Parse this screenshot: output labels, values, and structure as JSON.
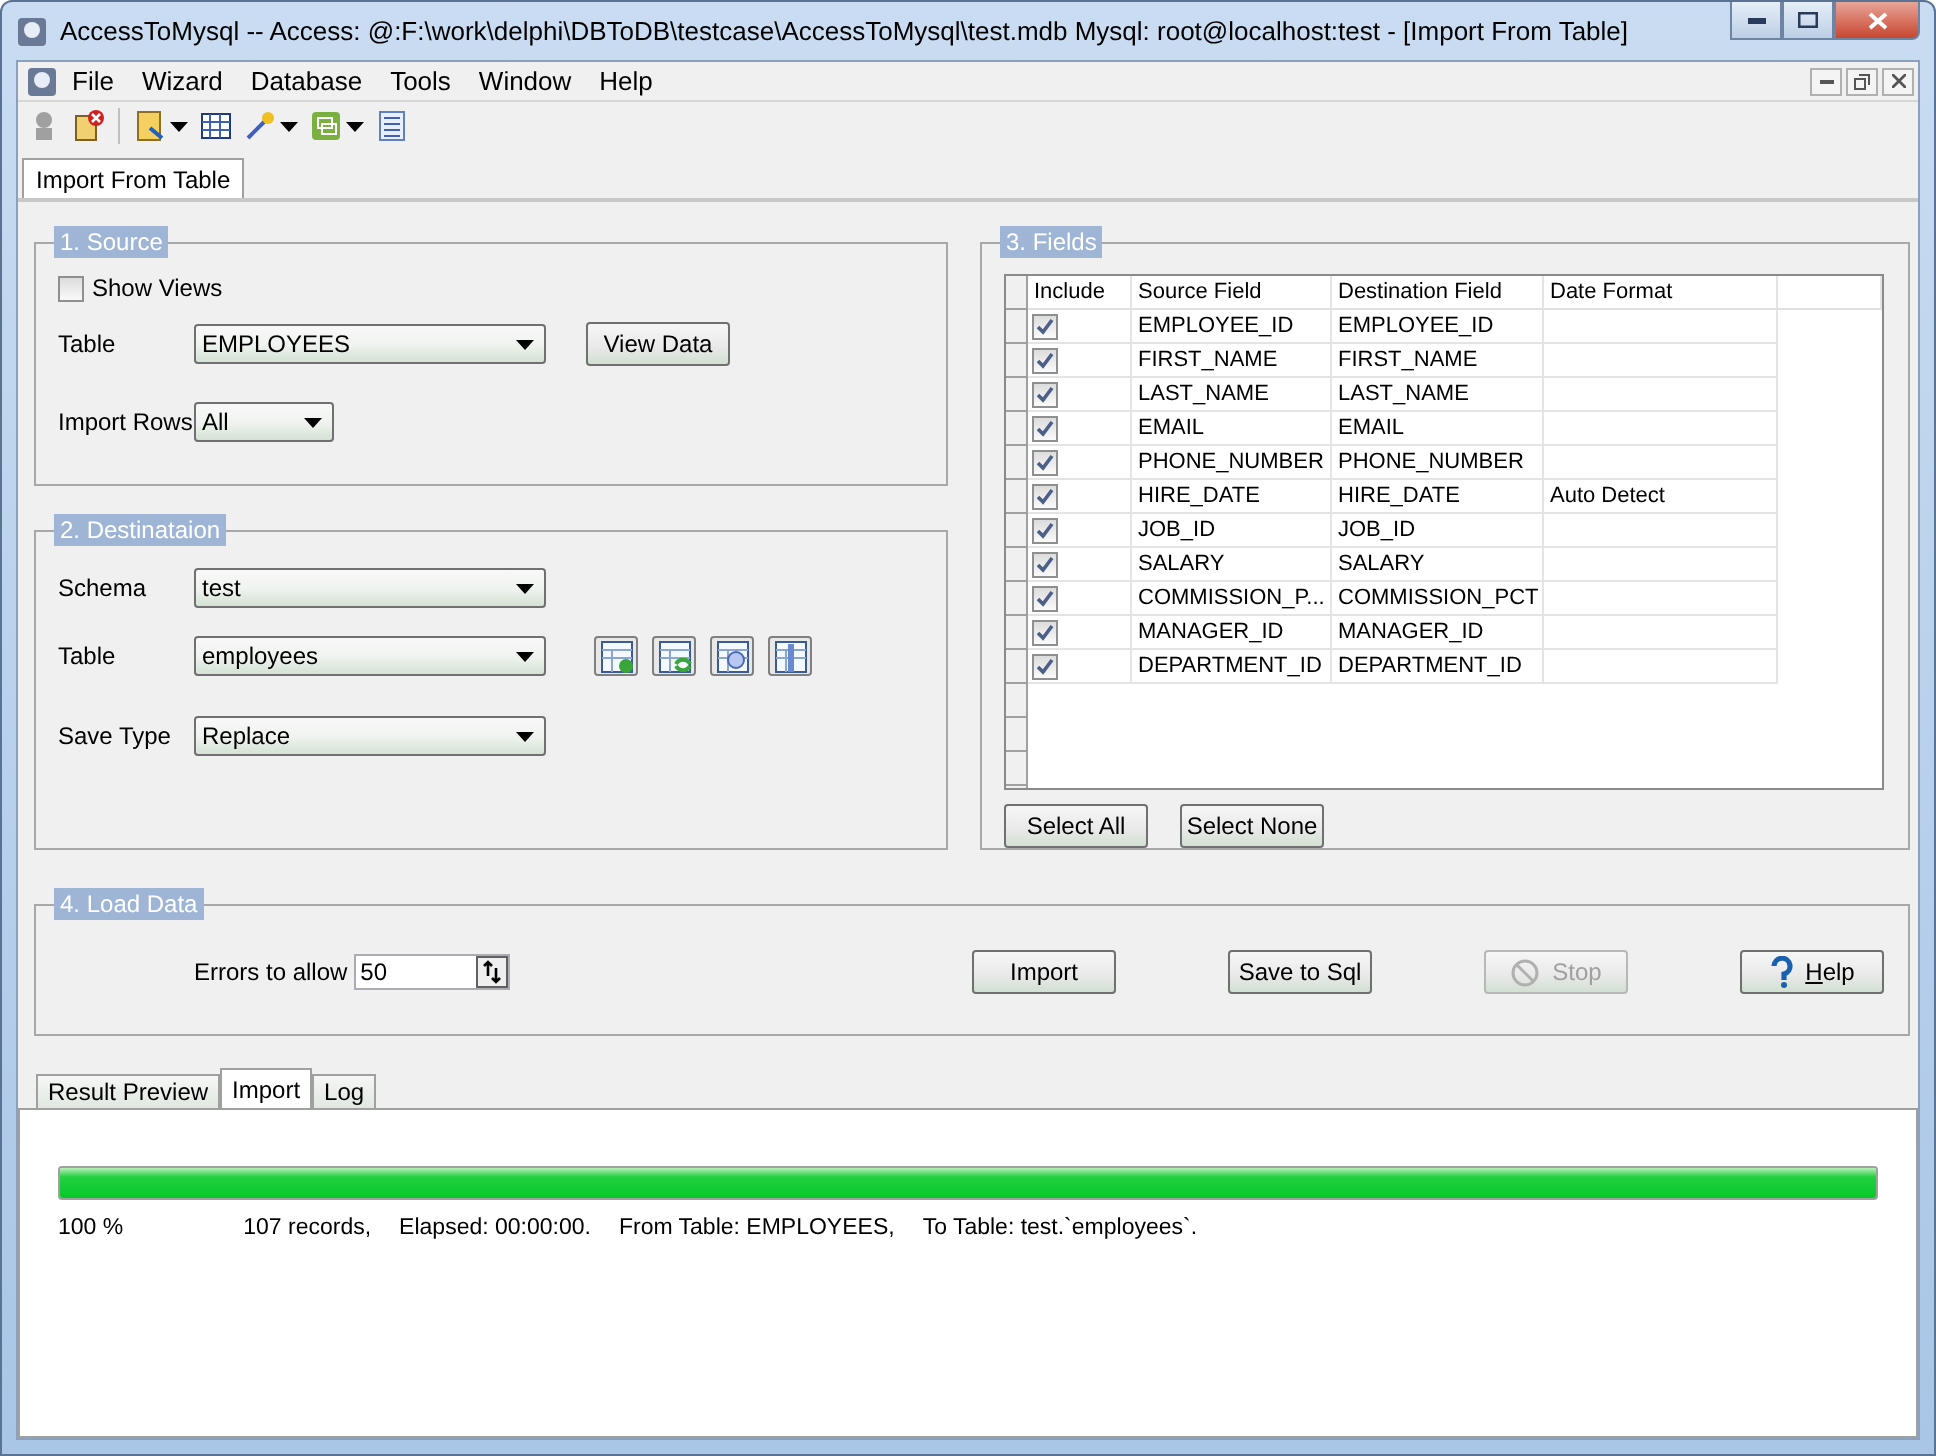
{
  "window": {
    "title": "AccessToMysql -- Access: @:F:\\work\\delphi\\DBToDB\\testcase\\AccessToMysql\\test.mdb Mysql: root@localhost:test - [Import From Table]"
  },
  "menu": [
    "File",
    "Wizard",
    "Database",
    "Tools",
    "Window",
    "Help"
  ],
  "document_tabs": [
    {
      "label": "Import From Table",
      "selected": true
    }
  ],
  "source": {
    "title": "1. Source",
    "show_views": {
      "label": "Show Views",
      "checked": false
    },
    "table": {
      "label": "Table",
      "value": "EMPLOYEES"
    },
    "view_data": "View Data",
    "import_rows": {
      "label": "Import Rows",
      "value": "All"
    }
  },
  "destination": {
    "title": "2. Destinataion",
    "schema": {
      "label": "Schema",
      "value": "test"
    },
    "table": {
      "label": "Table",
      "value": "employees"
    },
    "save_type": {
      "label": "Save Type",
      "value": "Replace"
    }
  },
  "fields": {
    "title": "3. Fields",
    "columns": [
      "Include",
      "Source Field",
      "Destination Field",
      "Date Format"
    ],
    "rows": [
      {
        "include": true,
        "source": "EMPLOYEE_ID",
        "destination": "EMPLOYEE_ID",
        "date_format": ""
      },
      {
        "include": true,
        "source": "FIRST_NAME",
        "destination": "FIRST_NAME",
        "date_format": ""
      },
      {
        "include": true,
        "source": "LAST_NAME",
        "destination": "LAST_NAME",
        "date_format": ""
      },
      {
        "include": true,
        "source": "EMAIL",
        "destination": "EMAIL",
        "date_format": ""
      },
      {
        "include": true,
        "source": "PHONE_NUMBER",
        "destination": "PHONE_NUMBER",
        "date_format": ""
      },
      {
        "include": true,
        "source": "HIRE_DATE",
        "destination": "HIRE_DATE",
        "date_format": "Auto Detect"
      },
      {
        "include": true,
        "source": "JOB_ID",
        "destination": "JOB_ID",
        "date_format": ""
      },
      {
        "include": true,
        "source": "SALARY",
        "destination": "SALARY",
        "date_format": ""
      },
      {
        "include": true,
        "source": "COMMISSION_P...",
        "destination": "COMMISSION_PCT",
        "date_format": ""
      },
      {
        "include": true,
        "source": "MANAGER_ID",
        "destination": "MANAGER_ID",
        "date_format": ""
      },
      {
        "include": true,
        "source": "DEPARTMENT_ID",
        "destination": "DEPARTMENT_ID",
        "date_format": ""
      }
    ],
    "buttons": [
      "Select All",
      "Select None"
    ]
  },
  "load_data": {
    "title": "4. Load Data",
    "errors_label": "Errors to allow",
    "errors_value": "50",
    "buttons": [
      {
        "label": "Import",
        "kind": "plain",
        "disabled": false
      },
      {
        "label": "Save to Sql",
        "kind": "plain",
        "disabled": false
      },
      {
        "label": "Stop",
        "kind": "stop",
        "disabled": true
      },
      {
        "label": "Help",
        "kind": "help",
        "disabled": false
      }
    ]
  },
  "bottom_tabs": [
    {
      "label": "Result Preview",
      "selected": false
    },
    {
      "label": "Import",
      "selected": true
    },
    {
      "label": "Log",
      "selected": false
    }
  ],
  "progress": {
    "level": 1,
    "percent": "100 %",
    "status": [
      "107 records,",
      "Elapsed: 00:00:00.",
      "From Table: EMPLOYEES,",
      "To Table: test.`employees`."
    ]
  }
}
